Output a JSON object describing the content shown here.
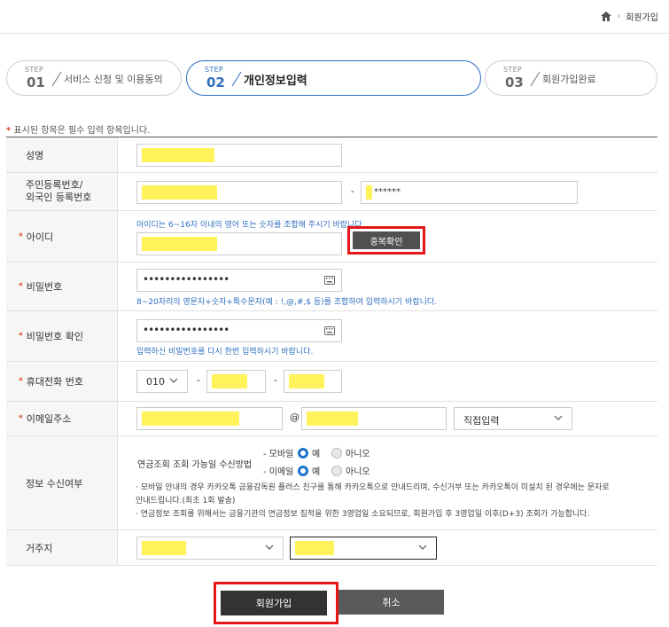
{
  "breadcrumb": {
    "current": "회원가입"
  },
  "steps": [
    {
      "label": "STEP",
      "number": "01",
      "name": "서비스 신청 및 이용동의"
    },
    {
      "label": "STEP",
      "number": "02",
      "name": "개인정보입력"
    },
    {
      "label": "STEP",
      "number": "03",
      "name": "회원가입완료"
    }
  ],
  "required_note": "표시된 항목은 필수 입력 항목입니다.",
  "required_mark": "*",
  "fields": {
    "name": {
      "label": "성명"
    },
    "rrn": {
      "label_line1": "주민등록번호/",
      "label_line2": "외국인 등록번호",
      "dash": "-",
      "masked": "******"
    },
    "userid": {
      "label": "아이디",
      "help": "아이디는 6~16자 이내의 영어 또는 숫자를 조합해 주시기 바랍니다.",
      "dup_button": "중복확인"
    },
    "password": {
      "label": "비밀번호",
      "value": "••••••••••••••••",
      "help": "8~20자리의 영문자+숫자+특수문자(예 : !,@,#,$ 등)를 조합하여 입력하시기 바랍니다."
    },
    "password_confirm": {
      "label": "비밀번호 확인",
      "value": "••••••••••••••••",
      "help": "입력하신 비밀번호를 다시 한번 입력하시기 바랍니다."
    },
    "phone": {
      "label": "휴대전화 번호",
      "prefix": "010",
      "dash": "-"
    },
    "email": {
      "label": "이메일주소",
      "at": "@",
      "domain_select": "직접입력"
    },
    "notify": {
      "label": "정보 수신여부",
      "method_label": "연금조회 조회 가능일 수신방법",
      "mobile_label": "- 모바일",
      "email_label": "- 이메일",
      "yes": "예",
      "no": "아니오",
      "note1": "· 모바일 안내의 경우 카카오톡 금융감독원 플러스 친구를 통해 카카오톡으로 안내드리며, 수신거부 또는 카카오톡이 미설치 된 경우에는 문자로",
      "note1b": "안내드립니다.(최초 1회 발송)",
      "note2": "· 연금정보 조회를 위해서는 금융기관의 연금정보 집적을 위한 3영업일 소요되므로, 회원가입 후 3영업일 이후(D+3) 조회가 가능합니다."
    },
    "residence": {
      "label": "거주지"
    }
  },
  "buttons": {
    "join": "회원가입",
    "cancel": "취소"
  },
  "colors": {
    "accent": "#2f6fbf",
    "required": "#e04a2b",
    "highlight": "#fff25a",
    "annotation": "#e51616"
  }
}
